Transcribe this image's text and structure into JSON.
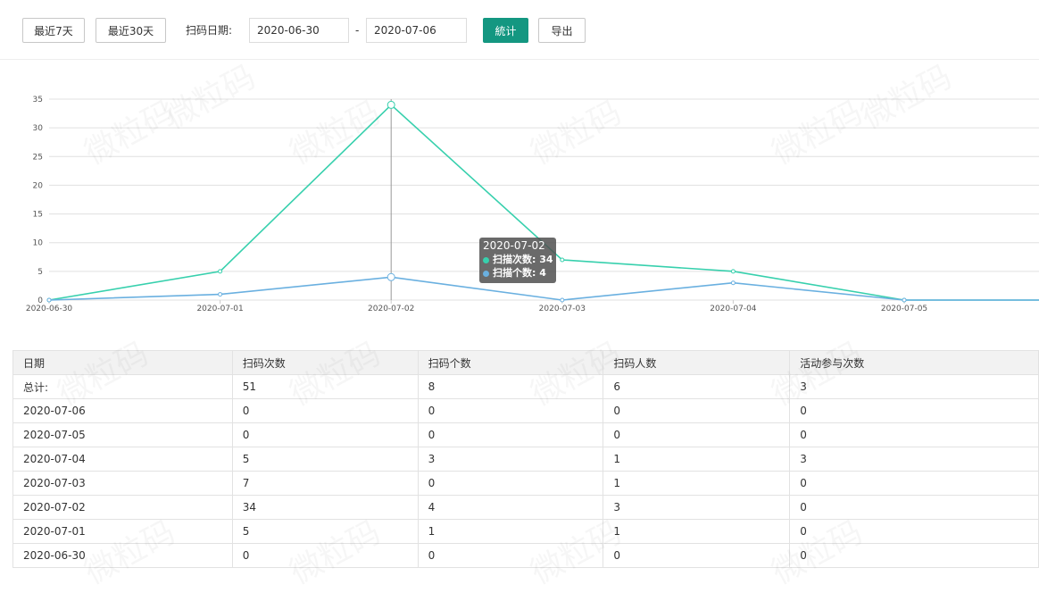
{
  "toolbar": {
    "btn_7": "最近7天",
    "btn_30": "最近30天",
    "date_label": "扫码日期:",
    "date_from": "2020-06-30",
    "date_sep": "-",
    "date_to": "2020-07-06",
    "stat_btn": "統计",
    "export_btn": "导出"
  },
  "colors": {
    "accent": "#149781",
    "series1": "#37d0ad",
    "series2": "#6ab0e0"
  },
  "chart_data": {
    "type": "line",
    "x": [
      "2020-06-30",
      "2020-07-01",
      "2020-07-02",
      "2020-07-03",
      "2020-07-04",
      "2020-07-05",
      "2020-07-06"
    ],
    "x_tick_labels": [
      "2020-06-30",
      "2020-07-01",
      "2020-07-02",
      "2020-07-03",
      "2020-07-04",
      "2020-07-05"
    ],
    "y_ticks": [
      "0",
      "5",
      "10",
      "15",
      "20",
      "25",
      "30",
      "35"
    ],
    "ylim": [
      0,
      35
    ],
    "grid": true,
    "series": [
      {
        "name": "扫描次数",
        "values": [
          0,
          5,
          34,
          7,
          5,
          0,
          0
        ],
        "color": "#37d0ad"
      },
      {
        "name": "扫描个数",
        "values": [
          0,
          1,
          4,
          0,
          3,
          0,
          0
        ],
        "color": "#6ab0e0"
      }
    ],
    "tooltip": {
      "title": "2020-07-02",
      "line1": "扫描次数: 34",
      "line2": "扫描个数: 4"
    }
  },
  "table": {
    "headers": [
      "日期",
      "扫码次数",
      "扫码个数",
      "扫码人数",
      "活动参与次数"
    ],
    "rows": [
      [
        "总计:",
        "51",
        "8",
        "6",
        "3"
      ],
      [
        "2020-07-06",
        "0",
        "0",
        "0",
        "0"
      ],
      [
        "2020-07-05",
        "0",
        "0",
        "0",
        "0"
      ],
      [
        "2020-07-04",
        "5",
        "3",
        "1",
        "3"
      ],
      [
        "2020-07-03",
        "7",
        "0",
        "1",
        "0"
      ],
      [
        "2020-07-02",
        "34",
        "4",
        "3",
        "0"
      ],
      [
        "2020-07-01",
        "5",
        "1",
        "1",
        "0"
      ],
      [
        "2020-06-30",
        "0",
        "0",
        "0",
        "0"
      ]
    ]
  },
  "watermark": "微粒码"
}
